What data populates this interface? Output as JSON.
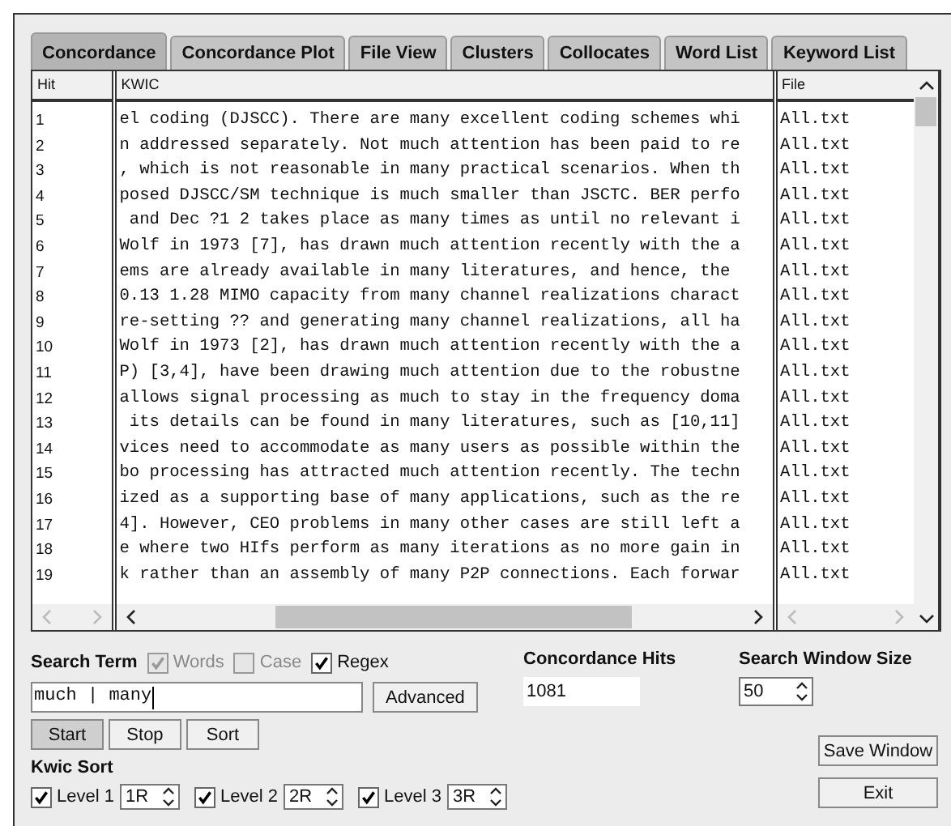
{
  "tabs": [
    {
      "label": "Concordance",
      "selected": true
    },
    {
      "label": "Concordance Plot",
      "selected": false
    },
    {
      "label": "File View",
      "selected": false
    },
    {
      "label": "Clusters",
      "selected": false
    },
    {
      "label": "Collocates",
      "selected": false
    },
    {
      "label": "Word List",
      "selected": false
    },
    {
      "label": "Keyword List",
      "selected": false
    }
  ],
  "table": {
    "columns": [
      "Hit",
      "KWIC",
      "File"
    ],
    "rows": [
      {
        "hit": "1",
        "kwic": "el coding (DJSCC). There are many excellent coding schemes whi",
        "file": "All.txt"
      },
      {
        "hit": "2",
        "kwic": "n addressed separately. Not much attention has been paid to re",
        "file": "All.txt"
      },
      {
        "hit": "3",
        "kwic": ", which is not reasonable in many practical scenarios. When th",
        "file": "All.txt"
      },
      {
        "hit": "4",
        "kwic": "posed DJSCC/SM technique is much smaller than JSCTC. BER perfo",
        "file": "All.txt"
      },
      {
        "hit": "5",
        "kwic": " and Dec ?1 2 takes place as many times as until no relevant i",
        "file": "All.txt"
      },
      {
        "hit": "6",
        "kwic": "Wolf in 1973 [7], has drawn much attention recently with the a",
        "file": "All.txt"
      },
      {
        "hit": "7",
        "kwic": "ems are already available in many literatures, and hence, the ",
        "file": "All.txt"
      },
      {
        "hit": "8",
        "kwic": "0.13 1.28 MIMO capacity from many channel realizations charact",
        "file": "All.txt"
      },
      {
        "hit": "9",
        "kwic": "re-setting ?? and generating many channel realizations, all ha",
        "file": "All.txt"
      },
      {
        "hit": "10",
        "kwic": "Wolf in 1973 [2], has drawn much attention recently with the a",
        "file": "All.txt"
      },
      {
        "hit": "11",
        "kwic": "P) [3,4], have been drawing much attention due to the robustne",
        "file": "All.txt"
      },
      {
        "hit": "12",
        "kwic": "allows signal processing as much to stay in the frequency doma",
        "file": "All.txt"
      },
      {
        "hit": "13",
        "kwic": " its details can be found in many literatures, such as [10,11]",
        "file": "All.txt"
      },
      {
        "hit": "14",
        "kwic": "vices need to accommodate as many users as possible within the",
        "file": "All.txt"
      },
      {
        "hit": "15",
        "kwic": "bo processing has attracted much attention recently. The techn",
        "file": "All.txt"
      },
      {
        "hit": "16",
        "kwic": "ized as a supporting base of many applications, such as the re",
        "file": "All.txt"
      },
      {
        "hit": "17",
        "kwic": "4]. However, CEO problems in many other cases are still left a",
        "file": "All.txt"
      },
      {
        "hit": "18",
        "kwic": "e where two HIfs perform as many iterations as no more gain in",
        "file": "All.txt"
      },
      {
        "hit": "19",
        "kwic": "k rather than an assembly of many P2P connections. Each forwar",
        "file": "All.txt"
      }
    ]
  },
  "search": {
    "label": "Search Term",
    "options": [
      {
        "label": "Words",
        "checked": true,
        "disabled": true
      },
      {
        "label": "Case",
        "checked": false,
        "disabled": true
      },
      {
        "label": "Regex",
        "checked": true,
        "disabled": false
      }
    ],
    "value": "much | many",
    "advanced": "Advanced"
  },
  "hits": {
    "label": "Concordance Hits",
    "value": "1081"
  },
  "window_size": {
    "label": "Search Window Size",
    "value": "50"
  },
  "actions": [
    {
      "label": "Start",
      "selected": true
    },
    {
      "label": "Stop",
      "selected": false
    },
    {
      "label": "Sort",
      "selected": false
    }
  ],
  "side_buttons": [
    "Save Window",
    "Exit"
  ],
  "kwic_sort": {
    "label": "Kwic Sort",
    "levels": [
      {
        "label": "Level 1",
        "checked": true,
        "value": "1R"
      },
      {
        "label": "Level 2",
        "checked": true,
        "value": "2R"
      },
      {
        "label": "Level 3",
        "checked": true,
        "value": "3R"
      }
    ]
  }
}
